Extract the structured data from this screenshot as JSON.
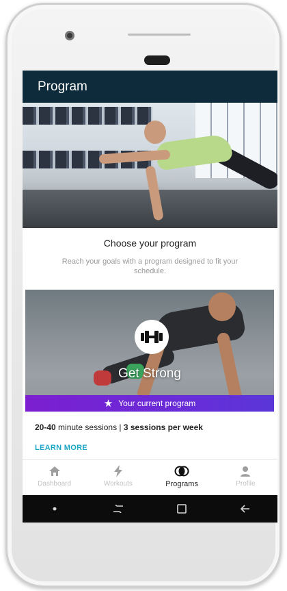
{
  "appbar": {
    "title": "Program"
  },
  "intro": {
    "title": "Choose your program",
    "subtitle": "Reach your goals with a program designed to fit your schedule."
  },
  "program_card": {
    "title": "Get Strong",
    "current_label": "Your current program",
    "badge_icon": "dumbbell-icon"
  },
  "details": {
    "minutes": "20-40",
    "minutes_suffix": " minute sessions | ",
    "sessions": "3 sessions per week",
    "learn_more": "LEARN MORE"
  },
  "bottom_nav": {
    "items": [
      {
        "label": "Dashboard",
        "icon": "home-icon",
        "active": false
      },
      {
        "label": "Workouts",
        "icon": "lightning-icon",
        "active": false
      },
      {
        "label": "Programs",
        "icon": "programs-icon",
        "active": true
      },
      {
        "label": "Profile",
        "icon": "person-icon",
        "active": false
      }
    ]
  },
  "colors": {
    "appbar": "#0d2b3a",
    "accent_purple": "#6a2bd8",
    "link": "#1ba5c5"
  }
}
